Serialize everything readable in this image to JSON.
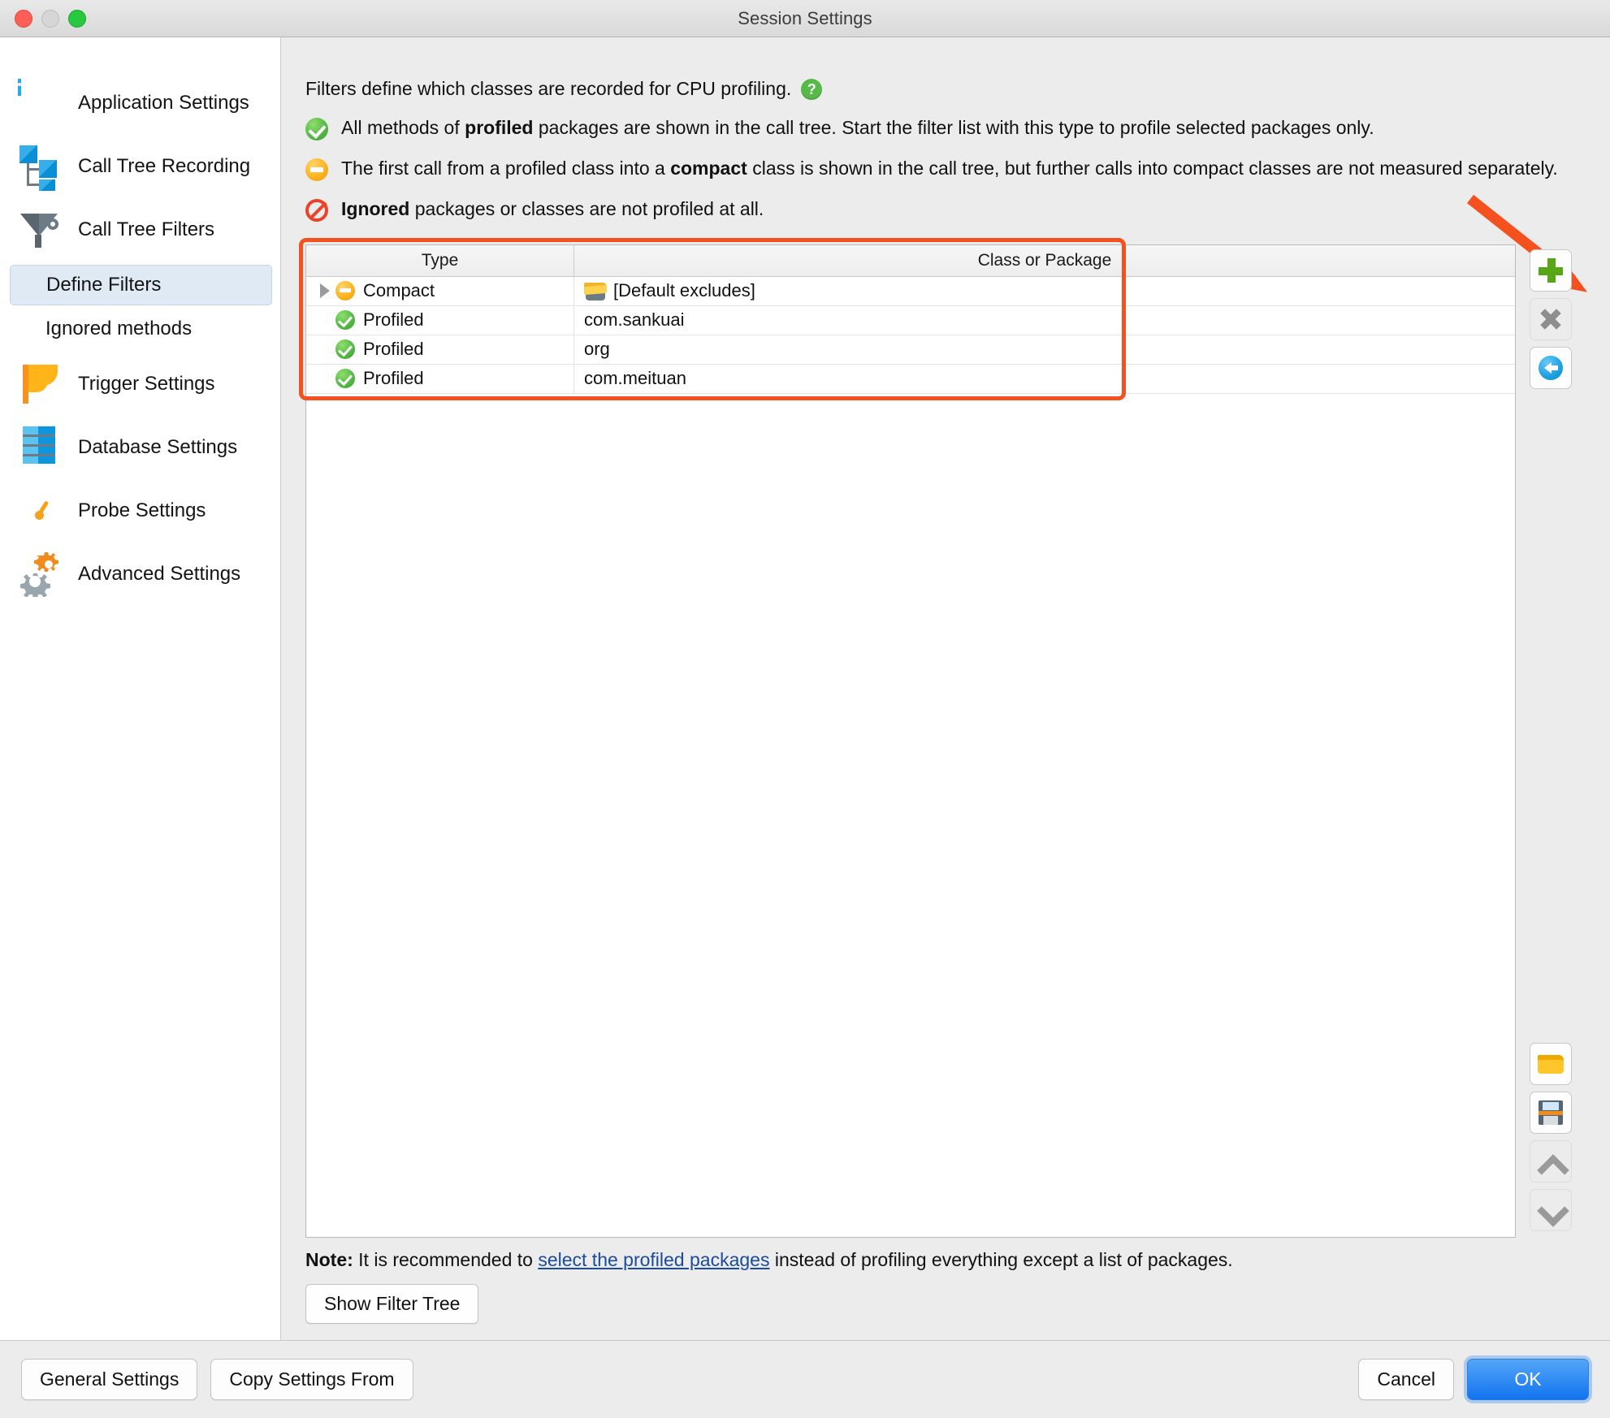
{
  "window": {
    "title": "Session Settings",
    "traffic_lights": [
      "close",
      "minimize",
      "zoom"
    ]
  },
  "sidebar": {
    "items": [
      {
        "label": "Application Settings",
        "icon": "app-window-icon",
        "selected": false,
        "sub": false
      },
      {
        "label": "Call Tree Recording",
        "icon": "call-tree-icon",
        "selected": false,
        "sub": false
      },
      {
        "label": "Call Tree Filters",
        "icon": "funnel-icon",
        "selected": false,
        "sub": false
      },
      {
        "label": "Define Filters",
        "icon": "",
        "selected": true,
        "sub": true
      },
      {
        "label": "Ignored methods",
        "icon": "",
        "selected": false,
        "sub": true
      },
      {
        "label": "Trigger Settings",
        "icon": "flag-icon",
        "selected": false,
        "sub": false
      },
      {
        "label": "Database Settings",
        "icon": "database-icon",
        "selected": false,
        "sub": false
      },
      {
        "label": "Probe Settings",
        "icon": "gauge-icon",
        "selected": false,
        "sub": false
      },
      {
        "label": "Advanced Settings",
        "icon": "gears-icon",
        "selected": false,
        "sub": false
      }
    ]
  },
  "header": {
    "intro": "Filters define which classes are recorded for CPU profiling.",
    "help_icon": "help-icon",
    "help_glyph": "?",
    "bullets": [
      {
        "icon": "profiled-check-icon",
        "icon_type": "check",
        "pre": "All methods of ",
        "strong": "profiled",
        "post": " packages are shown in the call tree. Start the filter list with this type to profile selected packages only."
      },
      {
        "icon": "compact-minus-icon",
        "icon_type": "minus",
        "pre": "The first call from a profiled class into a ",
        "strong": "compact",
        "post": " class is shown in the call tree, but further calls into compact classes are not measured separately."
      },
      {
        "icon": "ignored-ban-icon",
        "icon_type": "ban",
        "pre": "",
        "strong": "Ignored",
        "post": " packages or classes are not profiled at all."
      }
    ]
  },
  "table": {
    "columns": [
      "Type",
      "Class or Package"
    ],
    "rows": [
      {
        "expandable": true,
        "type_icon": "compact-minus-icon",
        "type": "Compact",
        "class_icon": "default-excludes-icon",
        "class_or_package": "[Default excludes]"
      },
      {
        "expandable": false,
        "type_icon": "profiled-check-icon",
        "type": "Profiled",
        "class_icon": "",
        "class_or_package": "com.sankuai"
      },
      {
        "expandable": false,
        "type_icon": "profiled-check-icon",
        "type": "Profiled",
        "class_icon": "",
        "class_or_package": "org"
      },
      {
        "expandable": false,
        "type_icon": "profiled-check-icon",
        "type": "Profiled",
        "class_icon": "",
        "class_or_package": "com.meituan"
      }
    ],
    "highlight_color": "#f4511e"
  },
  "side_toolbar": {
    "top": [
      {
        "name": "add-filter-button",
        "icon": "plus-icon"
      },
      {
        "name": "remove-filter-button",
        "icon": "close-x-icon"
      },
      {
        "name": "edit-filter-button",
        "icon": "edit-icon"
      }
    ],
    "bottom": [
      {
        "name": "open-filters-button",
        "icon": "folder-open-icon"
      },
      {
        "name": "save-filters-button",
        "icon": "floppy-save-icon"
      },
      {
        "name": "move-up-button",
        "icon": "chevron-up-icon"
      },
      {
        "name": "move-down-button",
        "icon": "chevron-down-icon"
      }
    ]
  },
  "annotation": {
    "arrow": "red-arrow-pointing-to-add-button",
    "color": "#f4511e"
  },
  "note": {
    "label": "Note:",
    "pre": " It is recommended to ",
    "link": "select the profiled packages",
    "post": " instead of profiling everything except a list of packages."
  },
  "buttons": {
    "show_filter_tree": "Show Filter Tree",
    "general_settings": "General Settings",
    "copy_settings_from": "Copy Settings From",
    "cancel": "Cancel",
    "ok": "OK"
  }
}
